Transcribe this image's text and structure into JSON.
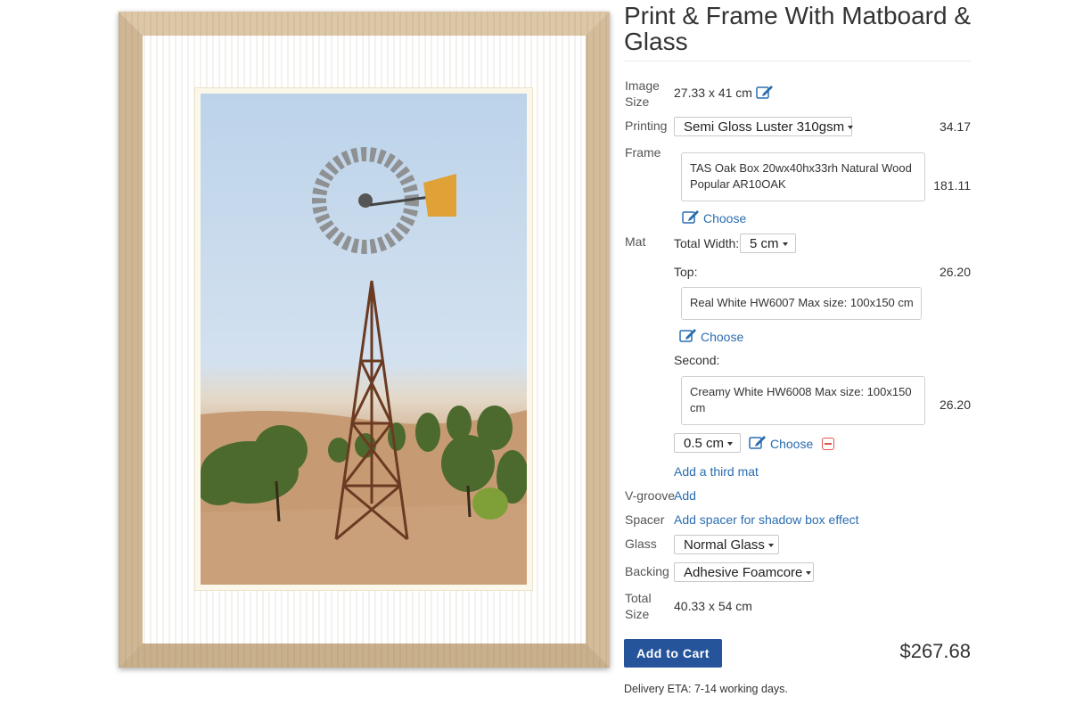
{
  "product": {
    "title": "Print & Frame With Matboard & Glass"
  },
  "image_size": {
    "label": "Image Size",
    "value": "27.33 x 41 cm"
  },
  "printing": {
    "label": "Printing",
    "selected": "Semi Gloss Luster 310gsm",
    "price": "34.17"
  },
  "frame": {
    "label": "Frame",
    "selected": "TAS Oak Box 20wx40hx33rh Natural Wood Popular AR10OAK",
    "price": "181.11",
    "choose_label": "Choose"
  },
  "mat": {
    "label": "Mat",
    "total_width_label": "Total Width:",
    "total_width_value": "5 cm",
    "top_label": "Top:",
    "top_price": "26.20",
    "top_selected": "Real White HW6007 Max size: 100x150 cm",
    "top_choose_label": "Choose",
    "second_label": "Second:",
    "second_selected": "Creamy White HW6008 Max size: 100x150 cm",
    "second_price": "26.20",
    "second_offset": "0.5 cm",
    "second_choose_label": "Choose",
    "add_third_label": "Add a third mat"
  },
  "vgroove": {
    "label": "V-groove",
    "action": "Add"
  },
  "spacer": {
    "label": "Spacer",
    "action": "Add spacer for shadow box effect"
  },
  "glass": {
    "label": "Glass",
    "selected": "Normal Glass"
  },
  "backing": {
    "label": "Backing",
    "selected": "Adhesive Foamcore"
  },
  "total_size": {
    "label": "Total Size",
    "value": "40.33 x 54 cm"
  },
  "cart": {
    "button_label": "Add to Cart",
    "total_price": "$267.68"
  },
  "delivery": {
    "eta": "Delivery ETA: 7-14 working days."
  },
  "icons": {
    "edit": "edit-icon",
    "remove": "remove-icon",
    "caret": "caret-down-icon"
  },
  "colors": {
    "accent": "#25549b",
    "link": "#2a6db0",
    "remove": "#e0544b",
    "frame_wood": "#d9c3a2"
  }
}
